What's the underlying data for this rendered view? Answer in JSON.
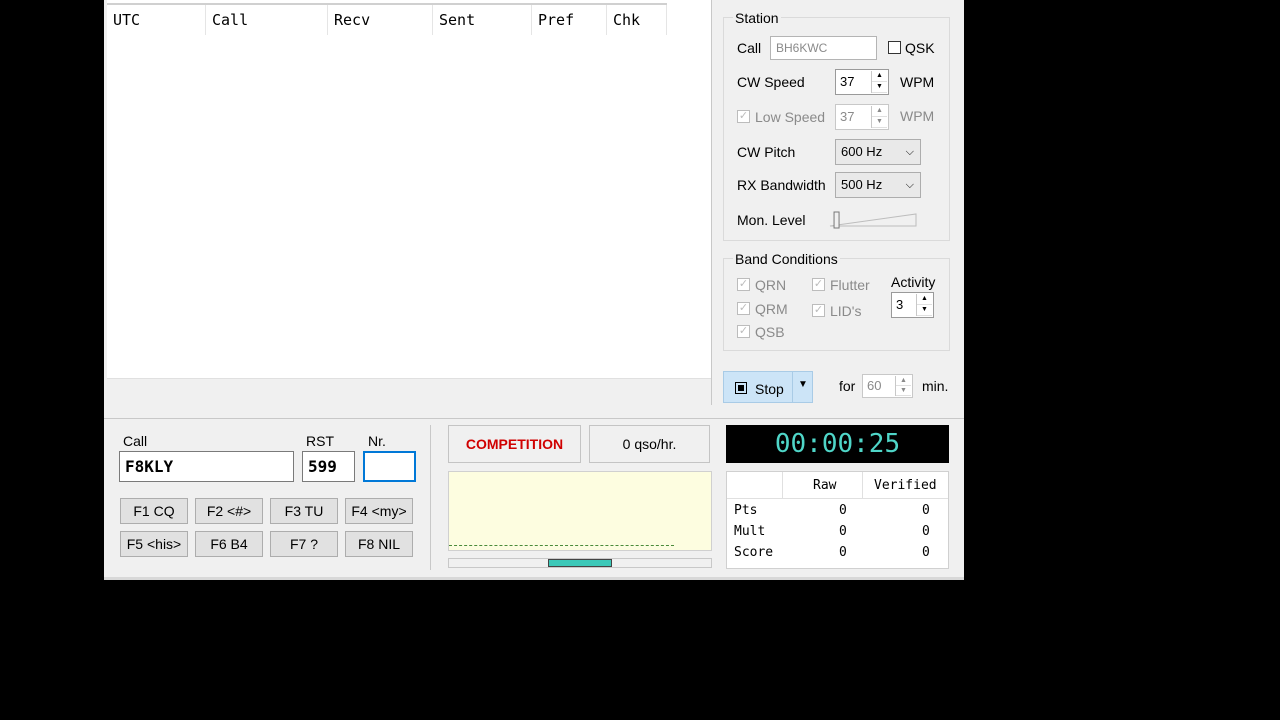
{
  "log": {
    "columns": [
      "UTC",
      "Call",
      "Recv",
      "Sent",
      "Pref",
      "Chk"
    ]
  },
  "station": {
    "title": "Station",
    "call_label": "Call",
    "call_value": "BH6KWC",
    "qsk_label": "QSK",
    "cw_speed_label": "CW Speed",
    "cw_speed_value": "37",
    "wpm_label": "WPM",
    "low_speed_label": "Low Speed",
    "low_speed_value": "37",
    "low_wpm_label": "WPM",
    "cw_pitch_label": "CW Pitch",
    "cw_pitch_value": "600 Hz",
    "rx_bw_label": "RX Bandwidth",
    "rx_bw_value": "500 Hz",
    "mon_level_label": "Mon. Level",
    "mon_level": 0.05
  },
  "band": {
    "title": "Band Conditions",
    "qrn": "QRN",
    "qrm": "QRM",
    "qsb": "QSB",
    "flutter": "Flutter",
    "lids": "LID's",
    "activity_label": "Activity",
    "activity_value": "3"
  },
  "run": {
    "stop_label": "Stop",
    "for_label": "for",
    "minutes_value": "60",
    "min_label": "min."
  },
  "entry": {
    "call_label": "Call",
    "call_value": "F8KLY",
    "rst_label": "RST",
    "rst_value": "599",
    "nr_label": "Nr.",
    "nr_value": ""
  },
  "fkeys": [
    "F1  CQ",
    "F2  <#>",
    "F3  TU",
    "F4  <my>",
    "F5  <his>",
    "F6  B4",
    "F7  ?",
    "F8  NIL"
  ],
  "status": {
    "mode": "COMPETITION",
    "rate": "0  qso/hr."
  },
  "timer": "00:00:25",
  "score": {
    "head_raw": "Raw",
    "head_verified": "Verified",
    "rows": [
      {
        "label": "Pts",
        "raw": "0",
        "verified": "0"
      },
      {
        "label": "Mult",
        "raw": "0",
        "verified": "0"
      },
      {
        "label": "Score",
        "raw": "0",
        "verified": "0"
      }
    ]
  },
  "colors": {
    "timer_bg": "#000000",
    "timer_fg": "#4fd6c8",
    "competition": "#d00000",
    "panel_bg": "#fdfde0",
    "accent": "#cce4f7"
  }
}
